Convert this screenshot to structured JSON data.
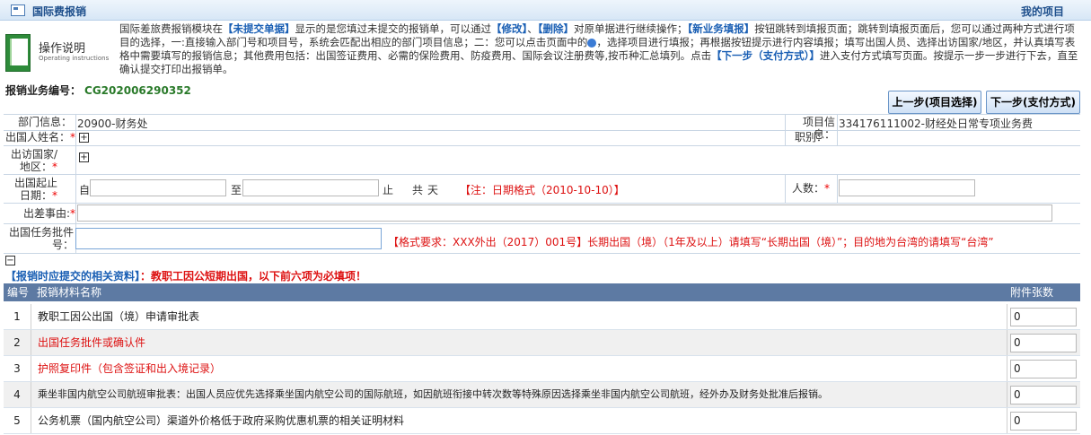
{
  "topbar": {
    "title": "国际费报销",
    "my_projects": "我的项目"
  },
  "help": {
    "title": "操作说明",
    "subtitle": "Operating instructions",
    "p1_a": "国际差旅费报销模块在",
    "p1_b": "【未提交单据】",
    "p1_c": "显示的是您填过未提交的报销单，可以通过",
    "p1_d": "【修改】",
    "p1_e": "、",
    "p1_f": "【删除】",
    "p1_g": "对原单据进行继续操作；",
    "p1_h": "【新业务填报】",
    "p1_i": "按钮跳转到填报页面；跳转到填报页面后，您可以通过两种方式进行项目的选择，一:直接输入部门号和项目号，系统会匹配出相应的部门项目信息；二：您可以点击页面中的",
    "p1_j": "，选择项目进行填报；再根据按钮提示进行内容填报；填写出国人员、选择出访国家/地区，并认真填写表格中需要填写的报销信息；其他费用包括：出国签证费用、必需的保险费用、防疫费用、国际会议注册费等,按币种汇总填列。点击",
    "p1_k": "【下一步（支付方式）】",
    "p1_l": "进入支付方式填写页面。按提示一步一步进行下去，直至确认提交打印出报销单。"
  },
  "biz": {
    "label": "报销业务编号：",
    "value": "CG202006290352"
  },
  "buttons": {
    "prev": "上一步(项目选择)",
    "next": "下一步(支付方式)"
  },
  "form": {
    "dept_label": "部门信息：",
    "dept_value": "20900-财务处",
    "proj_label": "项目信息：",
    "proj_value": "334176111002-财经处日常专项业务费",
    "person_label": "出国人姓名：",
    "title_label": "职别：",
    "country_label": "出访国家/地区：",
    "dates_label": "出国起止日期：",
    "from": "自",
    "to": "至",
    "stop": "止",
    "total": "共",
    "days": "天",
    "date_note": "【注：日期格式（2010-10-10）】",
    "count_label": "人数：",
    "reason_label": "出差事由:",
    "approval_label": "出国任务批件号：",
    "approval_note": "【格式要求：XXX外出（2017）001号】长期出国（境）（1年及以上）请填写“长期出国（境）”；目的地为台湾的请填写“台湾”",
    "req_mark": "*"
  },
  "section": {
    "a": "【报销时应提交的相关资料】",
    "b": "：教职工因公短期出国，以下前六项为必填项！"
  },
  "table": {
    "col_no": "编号",
    "col_name": "报销材料名称",
    "col_count": "附件张数",
    "rows": [
      {
        "no": "1",
        "name": "教职工因公出国（境）申请审批表",
        "count": "0"
      },
      {
        "no": "2",
        "name": "出国任务批件或确认件",
        "count": "0"
      },
      {
        "no": "3",
        "name": "护照复印件（包含签证和出入境记录）",
        "count": "0"
      },
      {
        "no": "4",
        "name": "乘坐非国内航空公司航班审批表：出国人员应优先选择乘坐国内航空公司的国际航班，如因航班衔接中转次数等特殊原因选择乘坐非国内航空公司航班，经外办及财务处批准后报销。",
        "count": "0"
      },
      {
        "no": "5",
        "name": "公务机票（国内航空公司）渠道外价格低于政府采购优惠机票的相关证明材料",
        "count": "0"
      }
    ]
  },
  "colors": {
    "header_bg": "#5d7aa3",
    "highlight": "#1a5fb4",
    "warning": "#d11",
    "biz_no": "#2a7a2a"
  }
}
